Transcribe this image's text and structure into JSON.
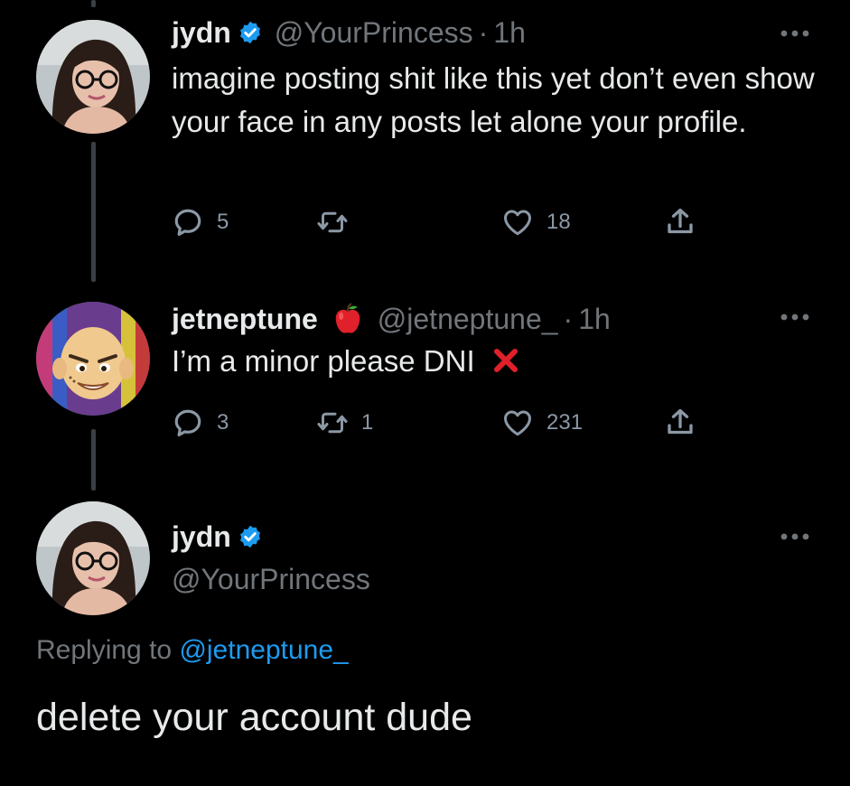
{
  "colors": {
    "background": "#000000",
    "text_primary": "#e7e9ea",
    "text_secondary": "#71767b",
    "accent": "#1d9bf0",
    "verified": "#1d9bf0",
    "x_mark": "#e0202a"
  },
  "tweets": [
    {
      "display_name": "jydn",
      "verified": true,
      "handle": "@YourPrincess",
      "separator": "·",
      "time": "1h",
      "text": "imagine posting shit like this yet don’t even show your face in any posts let alone your profile.",
      "more_icon": "more-horizontal-icon",
      "actions": {
        "reply_count": "5",
        "retweet_count": "",
        "like_count": "18"
      }
    },
    {
      "display_name": "jetneptune",
      "emoji": "red-apple-icon",
      "handle": "@jetneptune_",
      "separator": "·",
      "time": "1h",
      "text": "I’m a minor please DNI",
      "text_emoji": "cross-mark-icon",
      "more_icon": "more-horizontal-icon",
      "actions": {
        "reply_count": "3",
        "retweet_count": "1",
        "like_count": "231"
      }
    }
  ],
  "main_tweet": {
    "display_name": "jydn",
    "verified": true,
    "handle": "@YourPrincess",
    "replying_prefix": "Replying to",
    "replying_to": "@jetneptune_",
    "text": "delete your account dude",
    "more_icon": "more-horizontal-icon"
  }
}
